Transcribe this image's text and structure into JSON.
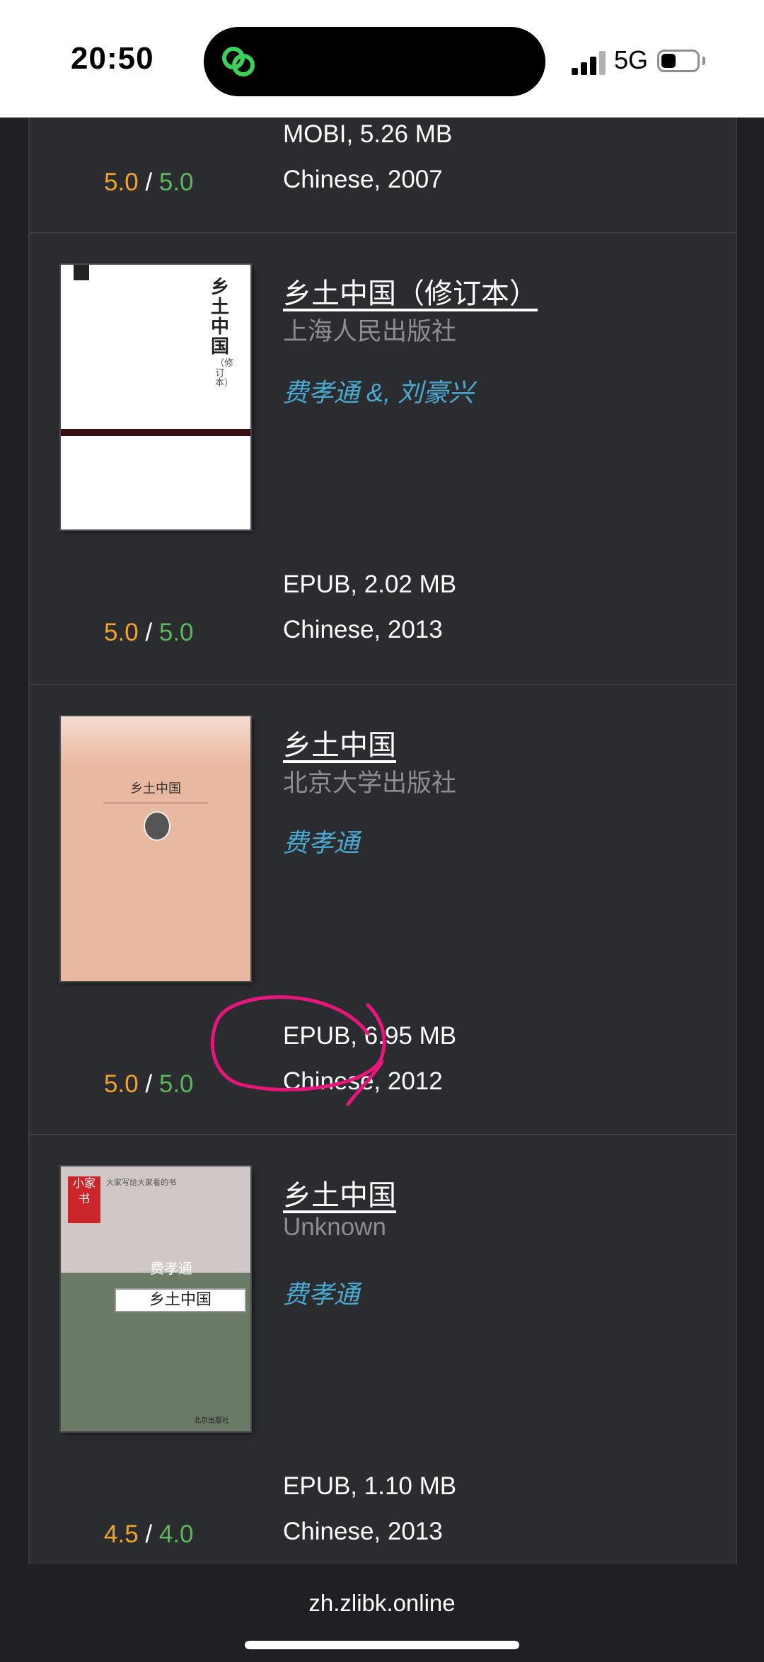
{
  "status_bar": {
    "time": "20:50",
    "network": "5G",
    "island_icon": "chain-link-icon"
  },
  "books": [
    {
      "title": "",
      "publisher": "",
      "author": "",
      "format_size": "MOBI, 5.26 MB",
      "language_year": "Chinese, 2007",
      "rating_a": "5.0",
      "rating_sep": "/",
      "rating_b": "5.0"
    },
    {
      "title": "乡土中国（修订本）",
      "publisher": "上海人民出版社",
      "author": "费孝通 &, 刘豪兴",
      "format_size": "EPUB, 2.02 MB",
      "language_year": "Chinese, 2013",
      "rating_a": "5.0",
      "rating_sep": "/",
      "rating_b": "5.0",
      "cover": {
        "vertical_title": "乡土中国",
        "subtitle": "（修订本）"
      }
    },
    {
      "title": "乡土中国",
      "publisher": "北京大学出版社",
      "author": "费孝通",
      "format_size": "EPUB, 6.95 MB",
      "language_year": "Chinese, 2012",
      "rating_a": "5.0",
      "rating_sep": "/",
      "rating_b": "5.0",
      "cover": {
        "title": "乡土中国"
      }
    },
    {
      "title": "乡土中国",
      "publisher": "Unknown",
      "author": "费孝通",
      "format_size": "EPUB, 1.10 MB",
      "language_year": "Chinese, 2013",
      "rating_a": "4.5",
      "rating_sep": "/",
      "rating_b": "4.0",
      "cover": {
        "seal": "小家书",
        "author": "费孝通",
        "title": "乡土中国",
        "top": "大家写给大家看的书",
        "publisher": "北京出版社"
      }
    }
  ],
  "bottom_bar": {
    "url": "zh.zlibk.online"
  },
  "colors": {
    "background": "#1f2023",
    "card": "#2b2c30",
    "author_link": "#49a9d0",
    "rating_a": "#f3a32a",
    "rating_b": "#5cb85c",
    "annotation": "#e8157a"
  }
}
